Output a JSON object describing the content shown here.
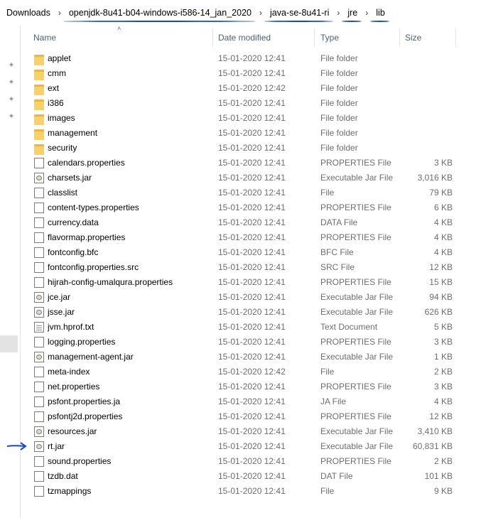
{
  "breadcrumb": [
    {
      "label": "Downloads",
      "underlined": false
    },
    {
      "label": "openjdk-8u41-b04-windows-i586-14_jan_2020",
      "underlined": true
    },
    {
      "label": "java-se-8u41-ri",
      "underlined": true
    },
    {
      "label": "jre",
      "underlined": true
    },
    {
      "label": "lib",
      "underlined": true
    }
  ],
  "columns": {
    "name": "Name",
    "date": "Date modified",
    "type": "Type",
    "size": "Size"
  },
  "colors": {
    "annotation": "#1a47c9",
    "folder": "#f7d16b",
    "header_text": "#4c607a",
    "secondary_text": "#6d6d6d"
  },
  "annotation": {
    "arrow_points_to": "rt.jar"
  },
  "files": [
    {
      "name": "applet",
      "date": "15-01-2020 12:41",
      "type": "File folder",
      "size": "",
      "icon": "folder-icon"
    },
    {
      "name": "cmm",
      "date": "15-01-2020 12:41",
      "type": "File folder",
      "size": "",
      "icon": "folder-icon"
    },
    {
      "name": "ext",
      "date": "15-01-2020 12:42",
      "type": "File folder",
      "size": "",
      "icon": "folder-icon"
    },
    {
      "name": "i386",
      "date": "15-01-2020 12:41",
      "type": "File folder",
      "size": "",
      "icon": "folder-icon"
    },
    {
      "name": "images",
      "date": "15-01-2020 12:41",
      "type": "File folder",
      "size": "",
      "icon": "folder-icon"
    },
    {
      "name": "management",
      "date": "15-01-2020 12:41",
      "type": "File folder",
      "size": "",
      "icon": "folder-icon"
    },
    {
      "name": "security",
      "date": "15-01-2020 12:41",
      "type": "File folder",
      "size": "",
      "icon": "folder-icon"
    },
    {
      "name": "calendars.properties",
      "date": "15-01-2020 12:41",
      "type": "PROPERTIES File",
      "size": "3 KB",
      "icon": "file-icon"
    },
    {
      "name": "charsets.jar",
      "date": "15-01-2020 12:41",
      "type": "Executable Jar File",
      "size": "3,016 KB",
      "icon": "jar-icon"
    },
    {
      "name": "classlist",
      "date": "15-01-2020 12:41",
      "type": "File",
      "size": "79 KB",
      "icon": "file-icon"
    },
    {
      "name": "content-types.properties",
      "date": "15-01-2020 12:41",
      "type": "PROPERTIES File",
      "size": "6 KB",
      "icon": "file-icon"
    },
    {
      "name": "currency.data",
      "date": "15-01-2020 12:41",
      "type": "DATA File",
      "size": "4 KB",
      "icon": "file-icon"
    },
    {
      "name": "flavormap.properties",
      "date": "15-01-2020 12:41",
      "type": "PROPERTIES File",
      "size": "4 KB",
      "icon": "file-icon"
    },
    {
      "name": "fontconfig.bfc",
      "date": "15-01-2020 12:41",
      "type": "BFC File",
      "size": "4 KB",
      "icon": "file-icon"
    },
    {
      "name": "fontconfig.properties.src",
      "date": "15-01-2020 12:41",
      "type": "SRC File",
      "size": "12 KB",
      "icon": "file-icon"
    },
    {
      "name": "hijrah-config-umalqura.properties",
      "date": "15-01-2020 12:41",
      "type": "PROPERTIES File",
      "size": "15 KB",
      "icon": "file-icon"
    },
    {
      "name": "jce.jar",
      "date": "15-01-2020 12:41",
      "type": "Executable Jar File",
      "size": "94 KB",
      "icon": "jar-icon"
    },
    {
      "name": "jsse.jar",
      "date": "15-01-2020 12:41",
      "type": "Executable Jar File",
      "size": "626 KB",
      "icon": "jar-icon"
    },
    {
      "name": "jvm.hprof.txt",
      "date": "15-01-2020 12:41",
      "type": "Text Document",
      "size": "5 KB",
      "icon": "text-file-icon"
    },
    {
      "name": "logging.properties",
      "date": "15-01-2020 12:41",
      "type": "PROPERTIES File",
      "size": "3 KB",
      "icon": "file-icon"
    },
    {
      "name": "management-agent.jar",
      "date": "15-01-2020 12:41",
      "type": "Executable Jar File",
      "size": "1 KB",
      "icon": "jar-icon"
    },
    {
      "name": "meta-index",
      "date": "15-01-2020 12:42",
      "type": "File",
      "size": "2 KB",
      "icon": "file-icon"
    },
    {
      "name": "net.properties",
      "date": "15-01-2020 12:41",
      "type": "PROPERTIES File",
      "size": "3 KB",
      "icon": "file-icon"
    },
    {
      "name": "psfont.properties.ja",
      "date": "15-01-2020 12:41",
      "type": "JA File",
      "size": "4 KB",
      "icon": "file-icon"
    },
    {
      "name": "psfontj2d.properties",
      "date": "15-01-2020 12:41",
      "type": "PROPERTIES File",
      "size": "12 KB",
      "icon": "file-icon"
    },
    {
      "name": "resources.jar",
      "date": "15-01-2020 12:41",
      "type": "Executable Jar File",
      "size": "3,410 KB",
      "icon": "jar-icon"
    },
    {
      "name": "rt.jar",
      "date": "15-01-2020 12:41",
      "type": "Executable Jar File",
      "size": "60,831 KB",
      "icon": "jar-icon"
    },
    {
      "name": "sound.properties",
      "date": "15-01-2020 12:41",
      "type": "PROPERTIES File",
      "size": "2 KB",
      "icon": "file-icon"
    },
    {
      "name": "tzdb.dat",
      "date": "15-01-2020 12:41",
      "type": "DAT File",
      "size": "101 KB",
      "icon": "file-icon"
    },
    {
      "name": "tzmappings",
      "date": "15-01-2020 12:41",
      "type": "File",
      "size": "9 KB",
      "icon": "file-icon"
    }
  ]
}
